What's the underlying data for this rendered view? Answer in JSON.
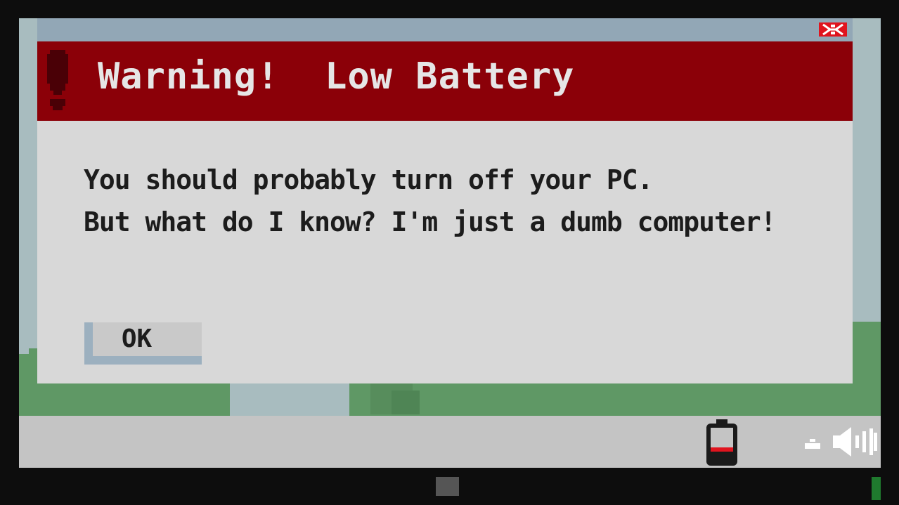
{
  "dialog": {
    "title": "Warning!  Low Battery",
    "message_lines": [
      "You should probably turn off your PC.",
      "But what do I know? I'm just a dumb computer!"
    ],
    "ok_label": "OK",
    "close_icon": "close-icon",
    "warning_icon": "exclamation-icon"
  },
  "taskbar": {
    "icons": [
      "battery-icon",
      "network-icon",
      "volume-icon"
    ],
    "battery_level": 0.15
  },
  "colors": {
    "warning_red": "#8b0008",
    "titlebar": "#92a7b6",
    "dialog_body": "#d8d8d8",
    "battery_low": "#e0141e",
    "power_led": "#1f7a2e"
  }
}
